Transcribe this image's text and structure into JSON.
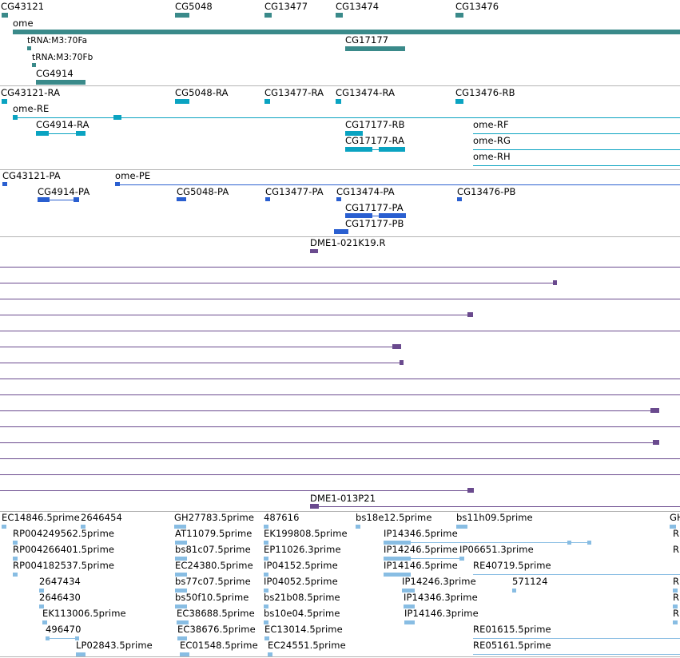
{
  "genes": {
    "labels": [
      "CG43121",
      "CG5048",
      "CG13477",
      "CG13474",
      "CG13476",
      "ome",
      "tRNA:M3:70Fa",
      "tRNA:M3:70Fb",
      "CG4914",
      "CG17177"
    ]
  },
  "transcripts": {
    "labels": [
      "CG43121-RA",
      "CG5048-RA",
      "CG13477-RA",
      "CG13474-RA",
      "CG13476-RB",
      "ome-RE",
      "CG4914-RA",
      "CG17177-RB",
      "CG17177-RA",
      "ome-RF",
      "ome-RG",
      "ome-RH"
    ]
  },
  "proteins": {
    "labels": [
      "CG43121-PA",
      "ome-PE",
      "CG4914-PA",
      "CG5048-PA",
      "CG13477-PA",
      "CG13474-PA",
      "CG13476-PB",
      "CG17177-PA",
      "CG17177-PB"
    ]
  },
  "bacs": {
    "labels": [
      "DME1-021K19.R",
      "DME1-013P21"
    ]
  },
  "ests": {
    "labels": [
      "EC14846.5prime",
      "2646454",
      "GH27783.5prime",
      "487616",
      "bs18e12.5prime",
      "bs11h09.5prime",
      "GH",
      "RP004249562.5prime",
      "AT11079.5prime",
      "EK199808.5prime",
      "IP14346.5prime",
      "R",
      "RP004266401.5prime",
      "bs81c07.5prime",
      "EP11026.3prime",
      "IP14246.5prime",
      "IP06651.3prime",
      "R",
      "RP004182537.5prime",
      "EC24380.5prime",
      "IP04152.5prime",
      "IP14146.5prime",
      "RE40719.5prime",
      "2647434",
      "bs77c07.5prime",
      "IP04052.5prime",
      "IP14246.3prime",
      "571124",
      "R",
      "2646430",
      "bs50f10.5prime",
      "bs21b08.5prime",
      "IP14346.3prime",
      "R",
      "EK113006.5prime",
      "EC38688.5prime",
      "bs10e04.5prime",
      "IP14146.3prime",
      "R",
      "496470",
      "EC38676.5prime",
      "EC13014.5prime",
      "RE01615.5prime",
      "LP02843.5prime",
      "EC01548.5prime",
      "EC24551.5prime",
      "RE05161.5prime"
    ]
  }
}
